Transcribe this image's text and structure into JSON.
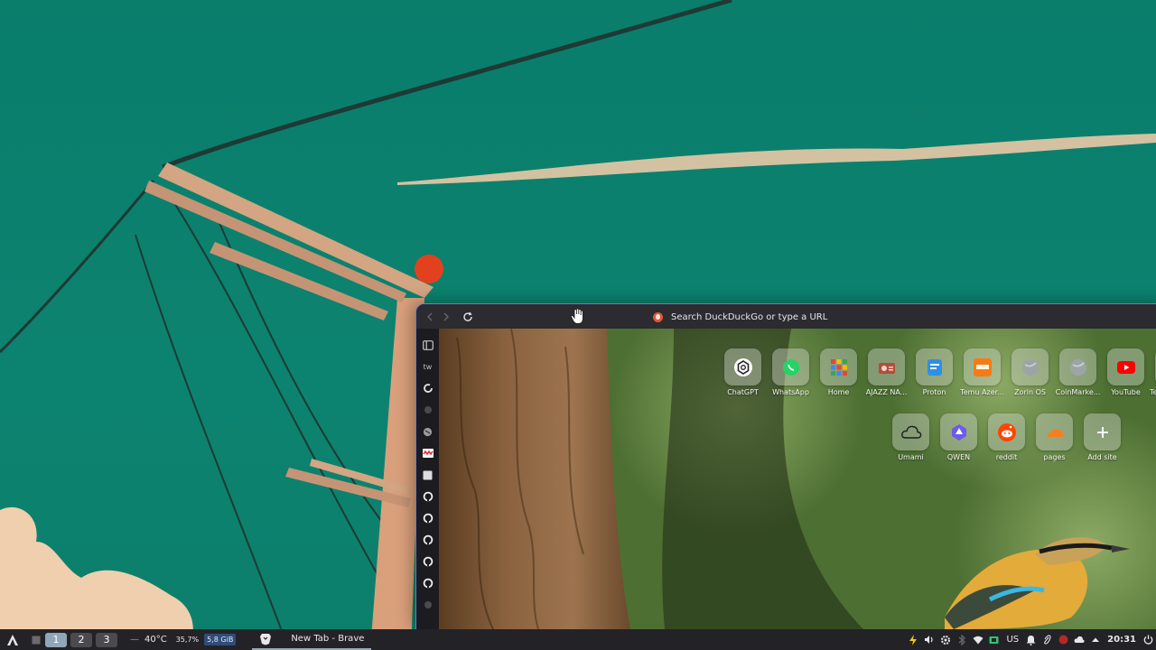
{
  "browser": {
    "url_placeholder": "Search DuckDuckGo or type a URL",
    "sidebar": [
      {
        "icon": "sidebar-panel-icon"
      },
      {
        "icon": "tw-icon",
        "label": "tw"
      },
      {
        "icon": "reload-site-icon"
      },
      {
        "icon": "faded-site-icon"
      },
      {
        "icon": "globe-site-icon"
      },
      {
        "icon": "red-site-icon"
      },
      {
        "icon": "page-site-icon"
      },
      {
        "icon": "github-icon"
      },
      {
        "icon": "github-icon"
      },
      {
        "icon": "github-icon"
      },
      {
        "icon": "github-icon"
      },
      {
        "icon": "github-icon"
      },
      {
        "icon": "faded-site-icon"
      }
    ],
    "tiles_row1": [
      {
        "label": "ChatGPT",
        "icon": "chatgpt-icon"
      },
      {
        "label": "WhatsApp",
        "icon": "whatsapp-icon"
      },
      {
        "label": "Home",
        "icon": "home-grid-icon"
      },
      {
        "label": "AJAZZ NA...",
        "icon": "radio-icon"
      },
      {
        "label": "Proton",
        "icon": "proton-icon"
      },
      {
        "label": "Temu Azer...",
        "icon": "temu-icon"
      },
      {
        "label": "Zorin OS",
        "icon": "globe-icon"
      },
      {
        "label": "CoinMarke...",
        "icon": "globe-icon"
      },
      {
        "label": "YouTube",
        "icon": "youtube-icon"
      },
      {
        "label": "Te",
        "icon": "globe-icon"
      }
    ],
    "tiles_row2": [
      {
        "label": "Umami",
        "icon": "cloud-icon"
      },
      {
        "label": "QWEN",
        "icon": "qwen-icon"
      },
      {
        "label": "reddit",
        "icon": "reddit-icon"
      },
      {
        "label": "pages",
        "icon": "cloudflare-icon"
      },
      {
        "label": "Add site",
        "icon": "plus-icon"
      }
    ]
  },
  "taskbar": {
    "workspaces": [
      "1",
      "2",
      "3"
    ],
    "active_workspace": "1",
    "separator": "—",
    "temperature": "40°C",
    "cpu": "35,7%",
    "memory": "5,8 GiB",
    "app_title": "New Tab - Brave",
    "keyboard_layout": "US",
    "clock": "20:31"
  }
}
